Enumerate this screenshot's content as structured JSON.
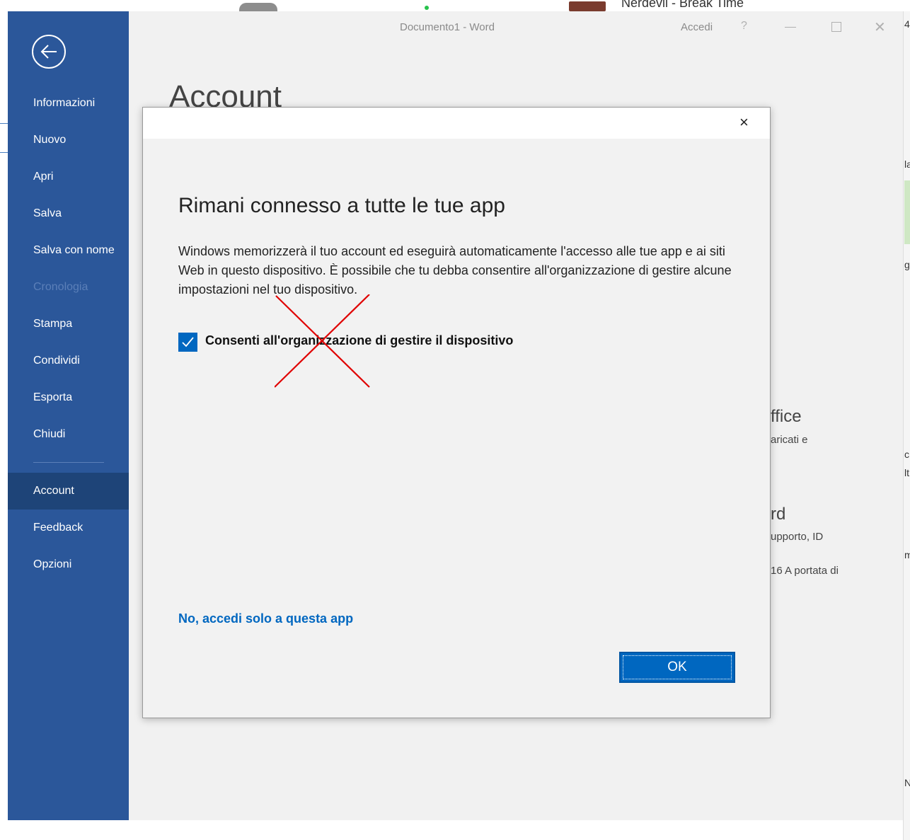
{
  "background": {
    "top_text": "Nerdevil - Break Time",
    "right_edge_texts": [
      "4",
      "la",
      "g",
      "c",
      "lt",
      "m",
      "N"
    ]
  },
  "window": {
    "title": "Documento1  -  Word",
    "signin": "Accedi",
    "help": "?"
  },
  "nav": {
    "items": [
      {
        "label": "Informazioni"
      },
      {
        "label": "Nuovo"
      },
      {
        "label": "Apri"
      },
      {
        "label": "Salva"
      },
      {
        "label": "Salva con nome"
      },
      {
        "label": "Cronologia"
      },
      {
        "label": "Stampa"
      },
      {
        "label": "Condividi"
      },
      {
        "label": "Esporta"
      },
      {
        "label": "Chiudi"
      },
      {
        "label": "Account"
      },
      {
        "label": "Feedback"
      },
      {
        "label": "Opzioni"
      }
    ],
    "selected": "Account",
    "disabled": "Cronologia"
  },
  "page": {
    "title": "Account",
    "background_texts": [
      "ffice",
      "aricati e",
      "rd",
      "upporto, ID",
      "16 A portata di"
    ]
  },
  "dialog": {
    "close": "×",
    "title": "Rimani connesso a tutte le tue app",
    "body": "Windows memorizzerà il tuo account ed eseguirà automaticamente l'accesso alle tue app e ai siti Web in questo dispositivo. È possibile che tu debba consentire all'organizzazione di gestire alcune impostazioni nel tuo dispositivo.",
    "checkbox_label": "Consenti all'organizzazione di gestire il dispositivo",
    "checkbox_checked": true,
    "link": "No, accedi solo a questa app",
    "ok": "OK"
  },
  "colors": {
    "nav_bg": "#2b579a",
    "nav_selected": "#1e4478",
    "accent": "#0067c0",
    "annotation_red": "#e00000"
  }
}
